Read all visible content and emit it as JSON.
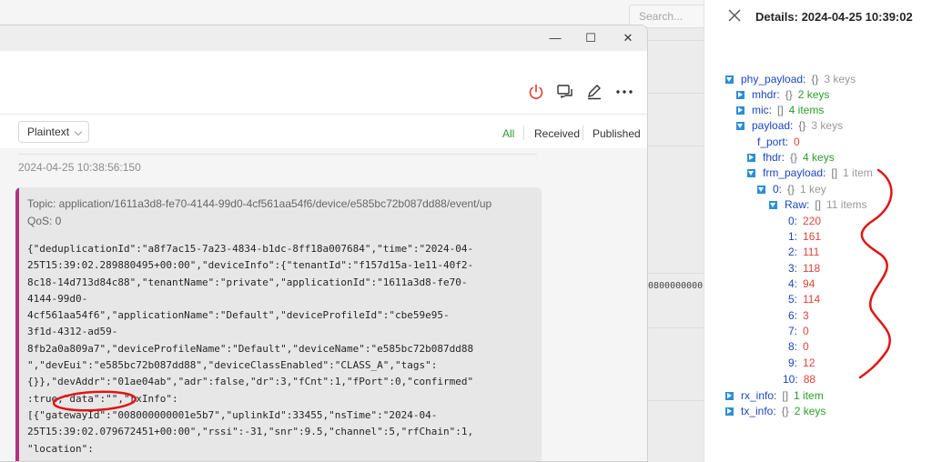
{
  "background": {
    "search_placeholder": "Search...",
    "id_fragment": "0800000000"
  },
  "window": {
    "controls": {
      "minimize": "—",
      "maximize": "☐",
      "close": "✕"
    },
    "toolbar": {
      "format": "Plaintext",
      "filters": [
        "All",
        "Received",
        "Published"
      ],
      "active_filter": "All"
    },
    "message": {
      "time": "2024-04-25 10:38:56:150",
      "topic": "Topic: application/1611a3d8-fe70-4144-99d0-4cf561aa54f6/device/e585bc72b087dd88/event/up",
      "qos": "QoS: 0",
      "payload_lines": [
        "{\"deduplicationId\":\"a8f7ac15-7a23-4834-b1dc-8ff18a007684\",\"time\":\"2024-04-",
        "25T15:39:02.289880495+00:00\",\"deviceInfo\":{\"tenantId\":\"f157d15a-1e11-40f2-",
        "8c18-14d713d84c88\",\"tenantName\":\"private\",\"applicationId\":\"1611a3d8-fe70-",
        "4144-99d0-",
        "4cf561aa54f6\",\"applicationName\":\"Default\",\"deviceProfileId\":\"cbe59e95-",
        "3f1d-4312-ad59-",
        "8fb2a0a809a7\",\"deviceProfileName\":\"Default\",\"deviceName\":\"e585bc72b087dd88",
        "\",\"devEui\":\"e585bc72b087dd88\",\"deviceClassEnabled\":\"CLASS_A\",\"tags\":",
        "{}},\"devAddr\":\"01ae04ab\",\"adr\":false,\"dr\":3,\"fCnt\":1,\"fPort\":0,\"confirmed\"",
        ":true,\"data\":\"\",\"rxInfo\":",
        "[{\"gatewayId\":\"008000000001e5b7\",\"uplinkId\":33455,\"nsTime\":\"2024-04-",
        "25T15:39:02.079672451+00:00\",\"rssi\":-31,\"snr\":9.5,\"channel\":5,\"rfChain\":1,",
        "\"location\":"
      ]
    }
  },
  "details": {
    "title": "Details: 2024-04-25 10:39:02",
    "nodes": [
      {
        "key": "phy_payload:",
        "brace": "{}",
        "count": "3 keys",
        "toggle": "open",
        "count_style": "grey"
      },
      {
        "key": "mhdr:",
        "brace": "{}",
        "count": "2 keys",
        "toggle": "closed",
        "count_style": "obj"
      },
      {
        "key": "mic:",
        "brace": "[]",
        "count": "4 items",
        "toggle": "closed",
        "count_style": "obj"
      },
      {
        "key": "payload:",
        "brace": "{}",
        "count": "3 keys",
        "toggle": "open",
        "count_style": "grey"
      },
      {
        "key": "f_port:",
        "value": "0"
      },
      {
        "key": "fhdr:",
        "brace": "{}",
        "count": "4 keys",
        "toggle": "closed",
        "count_style": "obj"
      },
      {
        "key": "frm_payload:",
        "brace": "[]",
        "count": "1 item",
        "toggle": "open",
        "count_style": "grey"
      },
      {
        "key": "0:",
        "brace": "{}",
        "count": "1 key",
        "toggle": "open",
        "count_style": "grey"
      },
      {
        "key": "Raw:",
        "brace": "[]",
        "count": "11 items",
        "toggle": "open",
        "count_style": "grey"
      },
      {
        "key": "0:",
        "value": "220"
      },
      {
        "key": "1:",
        "value": "161"
      },
      {
        "key": "2:",
        "value": "111"
      },
      {
        "key": "3:",
        "value": "118"
      },
      {
        "key": "4:",
        "value": "94"
      },
      {
        "key": "5:",
        "value": "114"
      },
      {
        "key": "6:",
        "value": "3"
      },
      {
        "key": "7:",
        "value": "0"
      },
      {
        "key": "8:",
        "value": "0"
      },
      {
        "key": "9:",
        "value": "12"
      },
      {
        "key": "10:",
        "value": "88"
      },
      {
        "key": "rx_info:",
        "brace": "[]",
        "count": "1 item",
        "toggle": "closed",
        "count_style": "obj"
      },
      {
        "key": "tx_info:",
        "brace": "{}",
        "count": "2 keys",
        "toggle": "closed",
        "count_style": "obj"
      }
    ]
  },
  "colors": {
    "accent_green": "#2a9d2a",
    "key_blue": "#1c46c0",
    "number_red": "#e0443b",
    "message_bar": "#b1337f",
    "annotation_red": "#e01515"
  }
}
